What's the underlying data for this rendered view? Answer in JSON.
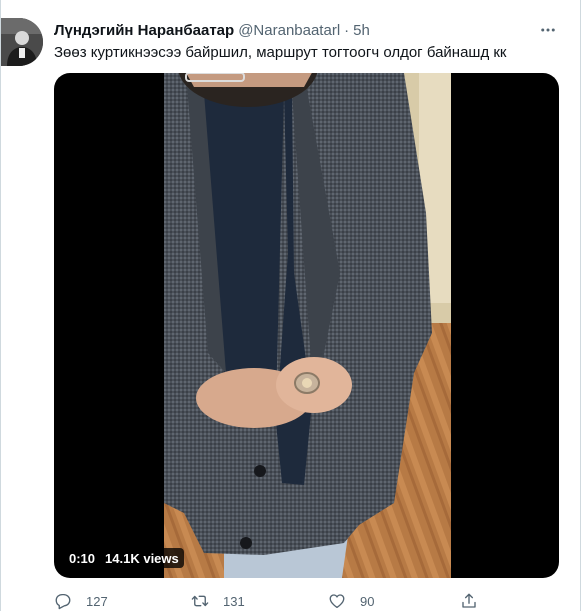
{
  "author": {
    "name": "Лүндэгийн Наранбаатар",
    "handle": "@Naranbaatarl",
    "separator": "·",
    "time": "5h"
  },
  "tweet": {
    "text": "Зөөз куртикнээсээ байршил, маршрут тогтоогч олдог байнашд кк"
  },
  "media": {
    "duration": "0:10",
    "views": "14.1K views"
  },
  "actions": {
    "replies": "127",
    "retweets": "131",
    "likes": "90"
  },
  "icons": {
    "more": "more-icon",
    "reply": "reply-icon",
    "retweet": "retweet-icon",
    "like": "heart-icon",
    "share": "share-icon"
  },
  "colors": {
    "text": "#0f1419",
    "secondary": "#536471",
    "border": "#cfd9de"
  }
}
